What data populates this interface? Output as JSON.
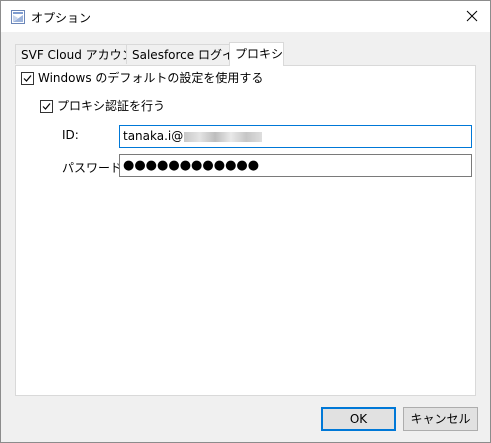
{
  "window": {
    "title": "オプション",
    "close_glyph": "✕"
  },
  "tabs": [
    {
      "label": "SVF Cloud アカウント",
      "active": false
    },
    {
      "label": "Salesforce ログイン",
      "active": false
    },
    {
      "label": "プロキシ",
      "active": true
    }
  ],
  "proxy": {
    "use_windows_default": {
      "label": "Windows のデフォルトの設定を使用する",
      "checked": true
    },
    "proxy_auth": {
      "label": "プロキシ認証を行う",
      "checked": true
    },
    "id": {
      "label": "ID:",
      "value": "tanaka.i@"
    },
    "password": {
      "label": "パスワード:",
      "value": "●●●●●●●●●●●●"
    }
  },
  "buttons": {
    "ok": "OK",
    "cancel": "キャンセル"
  },
  "colors": {
    "accent": "#0078d7",
    "window_bg": "#f0f0f0",
    "panel_bg": "#ffffff"
  }
}
